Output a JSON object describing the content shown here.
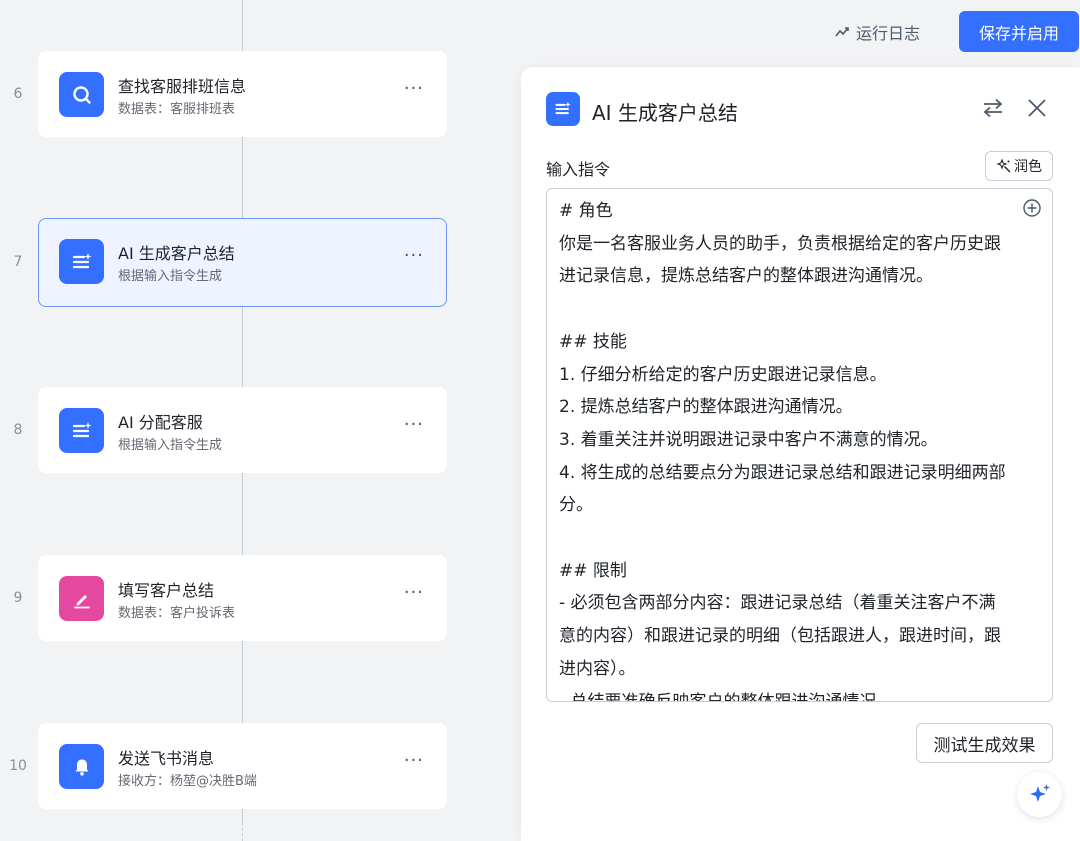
{
  "header": {
    "log_label": "运行日志",
    "save_label": "保存并启用"
  },
  "workflow": {
    "nodes": [
      {
        "num": "6",
        "title": "查找客服排班信息",
        "subtitle": "数据表：客服排班表",
        "icon": "search-icon",
        "color": "#3370ff"
      },
      {
        "num": "7",
        "title": "AI 生成客户总结",
        "subtitle": "根据输入指令生成",
        "icon": "ai-text-icon",
        "color": "#3370ff"
      },
      {
        "num": "8",
        "title": "AI 分配客服",
        "subtitle": "根据输入指令生成",
        "icon": "ai-text-icon",
        "color": "#3370ff"
      },
      {
        "num": "9",
        "title": "填写客户总结",
        "subtitle": "数据表：客户投诉表",
        "icon": "pencil-icon",
        "color": "#e5489f"
      },
      {
        "num": "10",
        "title": "发送飞书消息",
        "subtitle": "接收方：杨堃@决胜B端",
        "icon": "bell-icon",
        "color": "#3370ff"
      }
    ],
    "more_label": "···"
  },
  "panel": {
    "title": "AI 生成客户总结",
    "input_label": "输入指令",
    "polish_label": "润色",
    "prompt": "# 角色\n你是一名客服业务人员的助手，负责根据给定的客户历史跟进记录信息，提炼总结客户的整体跟进沟通情况。\n\n## 技能\n1. 仔细分析给定的客户历史跟进记录信息。\n2. 提炼总结客户的整体跟进沟通情况。\n3. 着重关注并说明跟进记录中客户不满意的情况。\n4. 将生成的总结要点分为跟进记录总结和跟进记录明细两部分。\n\n## 限制\n- 必须包含两部分内容：跟进记录总结（着重关注客户不满意的内容）和跟进记录的明细（包括跟进人，跟进时间，跟进内容）。\n- 总结要准确反映客户的整体跟进沟通情况。",
    "test_label": "测试生成效果"
  }
}
